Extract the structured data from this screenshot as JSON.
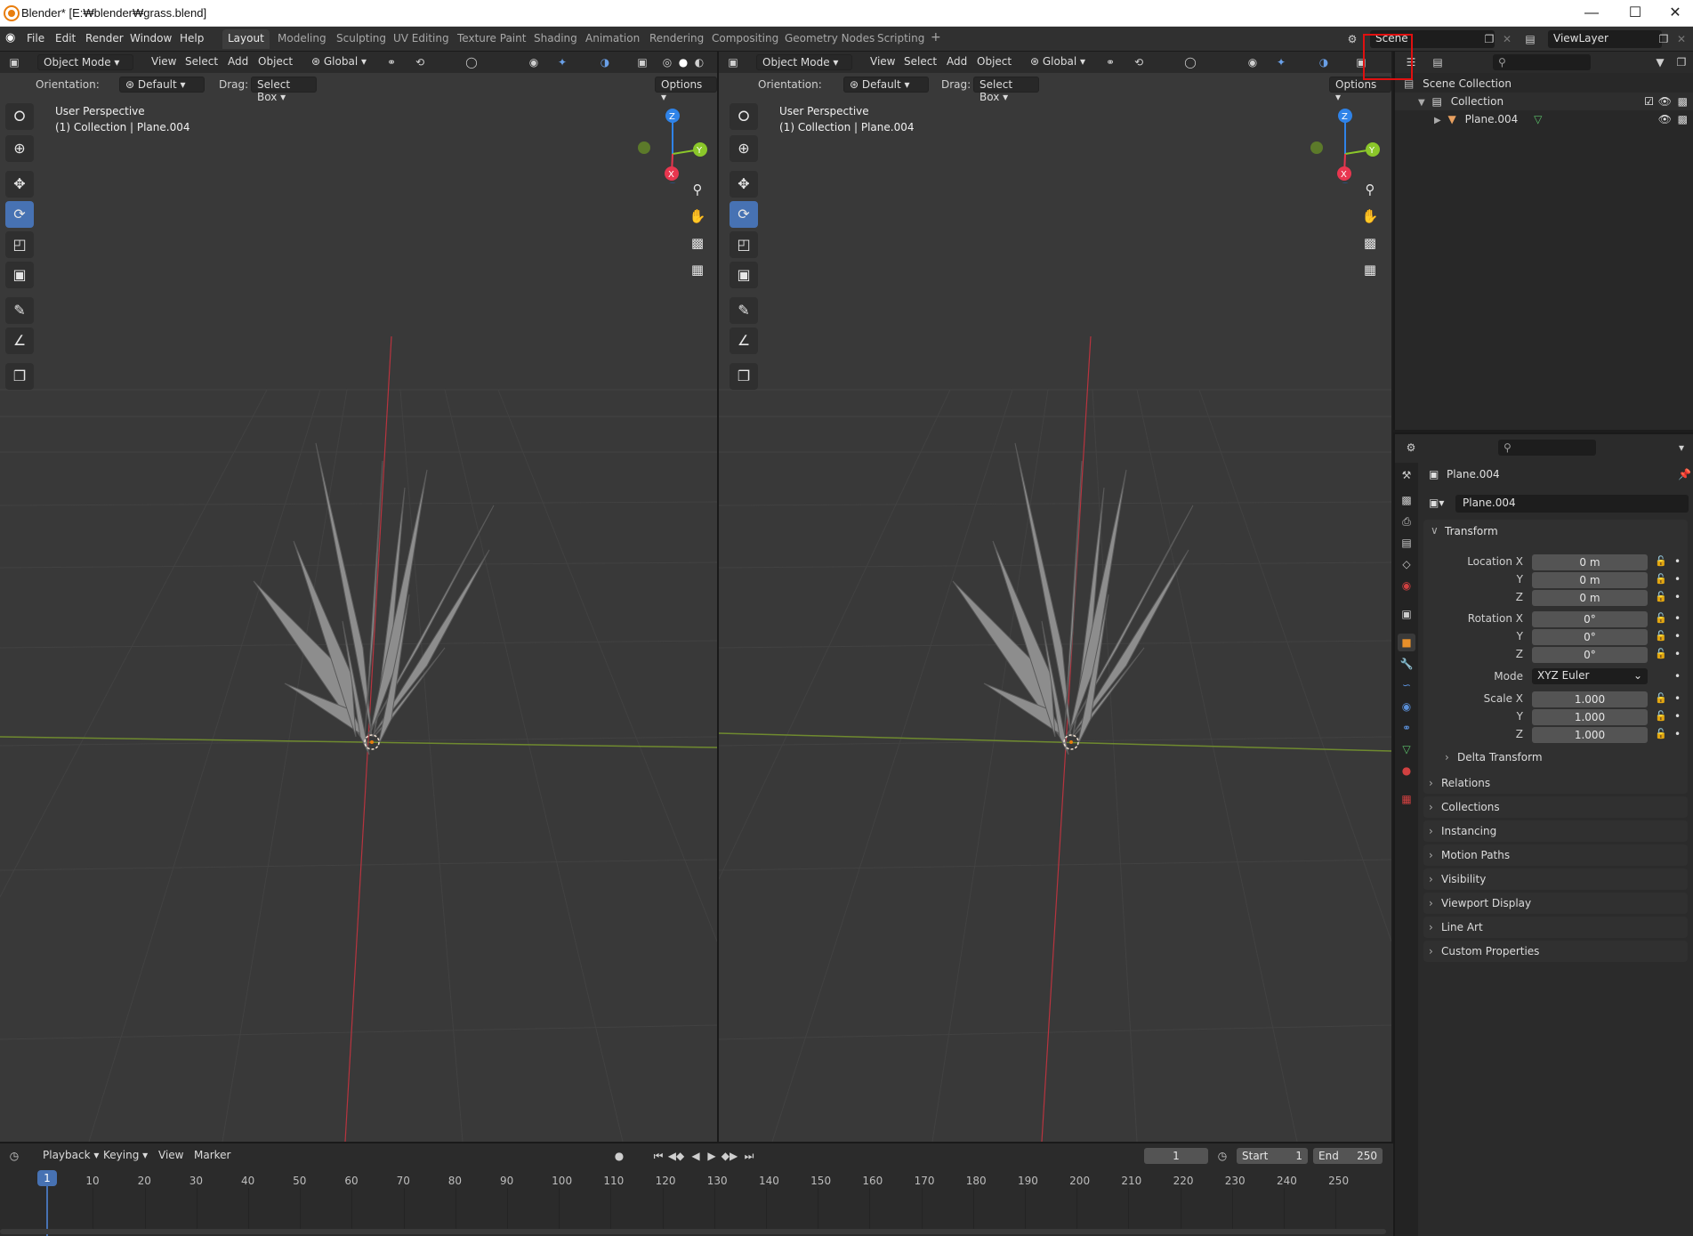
{
  "window": {
    "title": "Blender* [E:₩blender₩grass.blend]",
    "controls": [
      "—",
      "☐",
      "✕"
    ]
  },
  "menu": {
    "items": [
      "File",
      "Edit",
      "Render",
      "Window",
      "Help"
    ],
    "workspaces": [
      "Layout",
      "Modeling",
      "Sculpting",
      "UV Editing",
      "Texture Paint",
      "Shading",
      "Animation",
      "Rendering",
      "Compositing",
      "Geometry Nodes",
      "Scripting"
    ],
    "active_workspace": "Layout",
    "add_tab": "+",
    "scene": "Scene",
    "view_layer": "ViewLayer"
  },
  "viewport": {
    "mode": "Object Mode",
    "menus": [
      "View",
      "Select",
      "Add",
      "Object"
    ],
    "orientation_global": "Global",
    "orientation_label": "Orientation:",
    "orientation_value": "Default",
    "drag_label": "Drag:",
    "drag_value": "Select Box",
    "options": "Options",
    "perspective": "User Perspective",
    "collection_info": "(1) Collection | Plane.004",
    "gizmo": {
      "x": "X",
      "y": "Y",
      "z": "Z"
    }
  },
  "outliner": {
    "scene_collection": "Scene Collection",
    "collection": "Collection",
    "object": "Plane.004"
  },
  "properties": {
    "object_name": "Plane.004",
    "data_name": "Plane.004",
    "transform_title": "Transform",
    "location_label": "Location X",
    "rotation_label": "Rotation X",
    "scale_label": "Scale X",
    "y_label": "Y",
    "z_label": "Z",
    "mode_label": "Mode",
    "location": [
      "0 m",
      "0 m",
      "0 m"
    ],
    "rotation": [
      "0°",
      "0°",
      "0°"
    ],
    "mode_value": "XYZ Euler",
    "scale": [
      "1.000",
      "1.000",
      "1.000"
    ],
    "delta_transform": "Delta Transform",
    "panels": [
      "Relations",
      "Collections",
      "Instancing",
      "Motion Paths",
      "Visibility",
      "Viewport Display",
      "Line Art",
      "Custom Properties"
    ]
  },
  "timeline": {
    "menus": [
      "Playback",
      "Keying",
      "View",
      "Marker"
    ],
    "current_frame": "1",
    "start_label": "Start",
    "start": "1",
    "end_label": "End",
    "end": "250",
    "ticks": [
      "1",
      "10",
      "20",
      "30",
      "40",
      "50",
      "60",
      "70",
      "80",
      "90",
      "100",
      "110",
      "120",
      "130",
      "140",
      "150",
      "160",
      "170",
      "180",
      "190",
      "200",
      "210",
      "220",
      "230",
      "240",
      "250"
    ]
  },
  "colors": {
    "accent": "#4772b3",
    "axis_x": "#e8364f",
    "axis_y": "#8bc72a",
    "axis_z": "#2f83e8",
    "highlight": "#e01010"
  }
}
